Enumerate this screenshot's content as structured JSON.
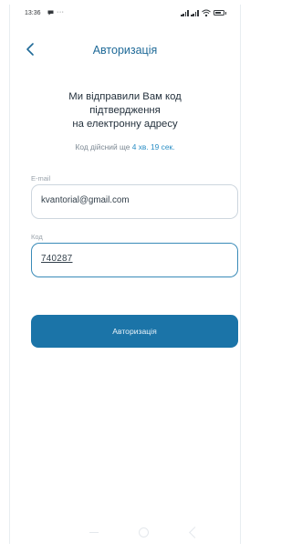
{
  "status_bar": {
    "time": "13:36",
    "more": "···"
  },
  "header": {
    "title": "Авторизація"
  },
  "message": {
    "line1": "Ми відправили Вам код",
    "line2": "підтвердження",
    "line3": "на електронну адресу"
  },
  "timer": {
    "prefix": "Код дійсний ще",
    "value": "4 хв. 19 сек."
  },
  "email": {
    "label": "E-mail",
    "value": "kvantorial@gmail.com"
  },
  "code": {
    "label": "Код",
    "value": "740287"
  },
  "submit": {
    "label": "Авторизація"
  },
  "colors": {
    "accent": "#1b74a8",
    "title": "#1f6a98"
  }
}
